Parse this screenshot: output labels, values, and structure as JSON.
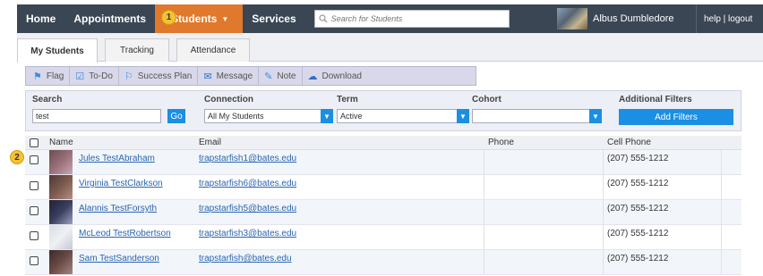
{
  "nav": {
    "items": [
      {
        "label": "Home"
      },
      {
        "label": "Appointments"
      },
      {
        "label": "Students",
        "active": true
      },
      {
        "label": "Services"
      }
    ],
    "search_placeholder": "Search for Students",
    "user_name": "Albus Dumbledore",
    "help_logout": "help | logout",
    "accent_color": "#e0792c",
    "nav_color": "#3a4654"
  },
  "badges": {
    "students": "1",
    "row_checkbox": "2"
  },
  "tabs": [
    {
      "label": "My Students",
      "active": true
    },
    {
      "label": "Tracking"
    },
    {
      "label": "Attendance"
    }
  ],
  "actions": [
    {
      "label": "Flag",
      "icon": "flag-icon"
    },
    {
      "label": "To-Do",
      "icon": "todo-icon"
    },
    {
      "label": "Success Plan",
      "icon": "success-plan-icon"
    },
    {
      "label": "Message",
      "icon": "envelope-icon"
    },
    {
      "label": "Note",
      "icon": "note-icon"
    },
    {
      "label": "Download",
      "icon": "cloud-download-icon"
    }
  ],
  "filters": {
    "search_label": "Search",
    "search_value": "test",
    "go_label": "Go",
    "connection_label": "Connection",
    "connection_value": "All My Students",
    "term_label": "Term",
    "term_value": "Active",
    "cohort_label": "Cohort",
    "cohort_value": "",
    "additional_label": "Additional Filters",
    "add_filters_label": "Add Filters"
  },
  "table": {
    "columns": {
      "name": "Name",
      "email": "Email",
      "phone": "Phone",
      "cell": "Cell Phone"
    },
    "rows": [
      {
        "name": "Jules TestAbraham",
        "email": "trapstarfish1@bates.edu",
        "phone": "",
        "cell": "(207) 555-1212"
      },
      {
        "name": "Virginia TestClarkson",
        "email": "trapstarfish6@bates.edu",
        "phone": "",
        "cell": "(207) 555-1212"
      },
      {
        "name": "Alannis TestForsyth",
        "email": "trapstarfish5@bates.edu",
        "phone": "",
        "cell": "(207) 555-1212"
      },
      {
        "name": "McLeod TestRobertson",
        "email": "trapstarfish3@bates.edu",
        "phone": "",
        "cell": "(207) 555-1212"
      },
      {
        "name": "Sam TestSanderson",
        "email": "trapstarfish@bates.edu",
        "phone": "",
        "cell": "(207) 555-1212"
      }
    ]
  }
}
